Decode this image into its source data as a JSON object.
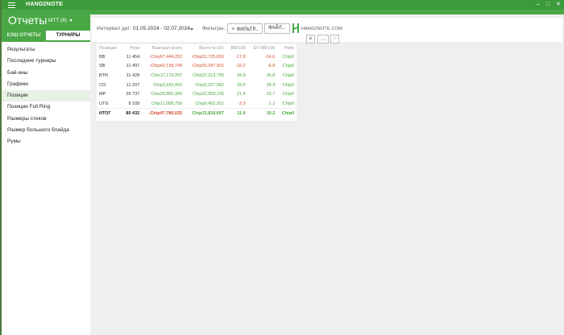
{
  "app": {
    "name": "HAND2NOTE"
  },
  "header": {
    "title": "Отчеты",
    "select_value": "MTT (8)"
  },
  "sidebar": {
    "tabs": [
      "КЭШ ОТЧЕТЫ",
      "ТУРНИРЫ"
    ],
    "items": [
      "Результаты",
      "Последние турниры",
      "Бай-ины",
      "Графики",
      "Позиции",
      "Позиции Full Ring",
      "Размеры стеков",
      "Размер большого блайда",
      "Румы"
    ]
  },
  "filterbar": {
    "date_label": "Интервал дат:",
    "date_value": "01.05.2024 - 02.07.2024",
    "filters_label": "Фильтры:",
    "filter_button": "ФИЛЬТР...",
    "file_button": "ФАЙЛ...",
    "logo_text": "HAND2NOTE.COM",
    "pager": [
      "<",
      "...",
      ">"
    ]
  },
  "table": {
    "columns": [
      "Позиция",
      "Руки",
      "Выиграл всего",
      "Всего по EV",
      "BB/100",
      "EV BB/100",
      "Рейк"
    ],
    "rows": [
      {
        "pos": "BB",
        "hands": "11 454",
        "won": "-Chip67,444,252",
        "ev": "-Chip21,725,650",
        "bb": "-17.8",
        "evbb": "-24.6",
        "rake": "Chip0"
      },
      {
        "pos": "SB",
        "hands": "11 497",
        "won": "-Chip42,138,749",
        "ev": "-Chip30,347,901",
        "bb": "-10.2",
        "evbb": "-6.8",
        "rake": "Chip0"
      },
      {
        "pos": "BTN",
        "hands": "11 428",
        "won": "Chip17,179,397",
        "ev": "Chip22,213,790",
        "bb": "34.8",
        "evbb": "36.8",
        "rake": "Chip0"
      },
      {
        "pos": "CO",
        "hands": "11 207",
        "won": "Chip3,642,463",
        "ev": "Chip2,167,982",
        "bb": "29.5",
        "evbb": "28.4",
        "rake": "Chip0"
      },
      {
        "pos": "MP",
        "hands": "26 737",
        "won": "Chip29,886,360",
        "ev": "Chip32,058,195",
        "bb": "21.4",
        "evbb": "15.7",
        "rake": "Chip0"
      },
      {
        "pos": "UTG",
        "hands": "8 109",
        "won": "Chip11,088,756",
        "ev": "Chip9,452,251",
        "bb": "-3.3",
        "evbb": "2.2",
        "rake": "Chip0"
      }
    ],
    "total": {
      "pos": "ИТОГ",
      "hands": "80 432",
      "won": "-Chip47,786,025",
      "ev": "Chip13,818,667",
      "bb": "11.9",
      "evbb": "10.2",
      "rake": "Chip0"
    }
  },
  "colors": {
    "brand_green": "#48a845",
    "negative": "#d24a2c",
    "positive": "#4aa83f"
  }
}
